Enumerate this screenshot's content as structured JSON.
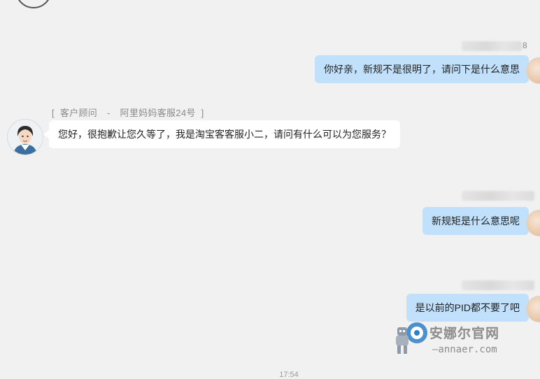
{
  "agent": {
    "label_open": "[",
    "label_role": "客户顾问",
    "label_sep": "-",
    "label_name": "阿里妈妈客服24号",
    "label_close": "]"
  },
  "messages": [
    {
      "id": "m1",
      "side": "out",
      "sender_suffix": "8",
      "text": "你好亲，新规不是很明了，请问下是什么意思"
    },
    {
      "id": "m2",
      "side": "in",
      "text": "您好，很抱歉让您久等了，我是淘宝客客服小二，请问有什么可以为您服务？"
    },
    {
      "id": "m3",
      "side": "out",
      "text": "新规矩是什么意思呢"
    },
    {
      "id": "m4",
      "side": "out",
      "text": "是以前的PID都不要了吧"
    }
  ],
  "timestamp": "17:54",
  "watermark": {
    "title": "安娜尔官网",
    "url": "—annaer.com"
  }
}
